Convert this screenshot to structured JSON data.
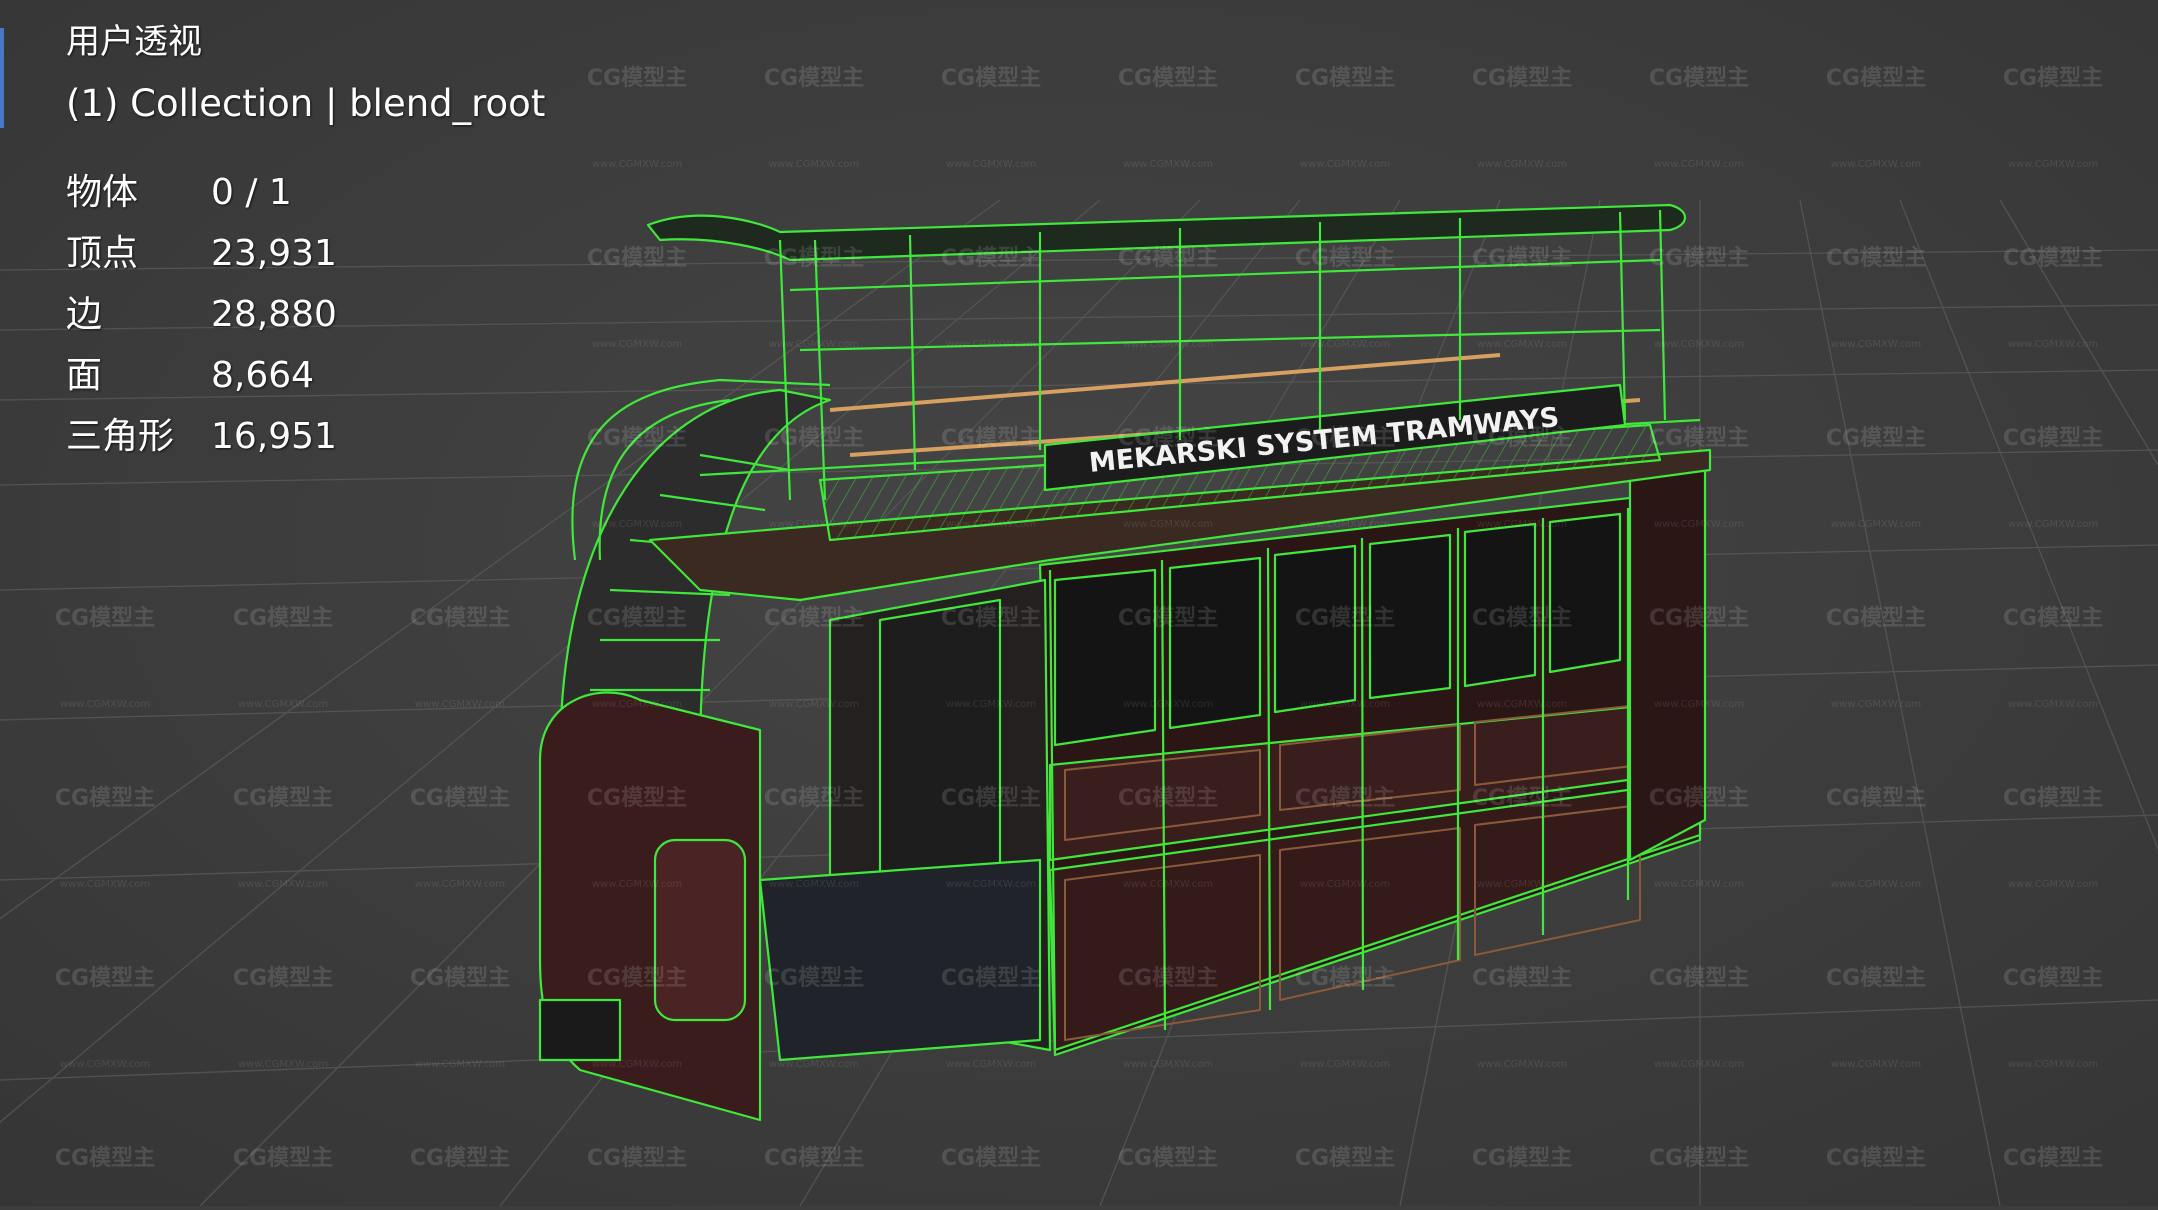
{
  "viewport": {
    "view_name": "用户透视",
    "collection_info": "(1) Collection | blend_root",
    "stats": [
      {
        "label": "物体",
        "value": "0 / 1"
      },
      {
        "label": "顶点",
        "value": "23,931"
      },
      {
        "label": "边",
        "value": "28,880"
      },
      {
        "label": "面",
        "value": "8,664"
      },
      {
        "label": "三角形",
        "value": "16,951"
      }
    ],
    "model": {
      "signboard_text": "MEKARSKI SYSTEM TRAMWAYS",
      "wire_color": "#3fe83a",
      "body_color": "#4a2424"
    },
    "watermark": {
      "logo": "CG模型主",
      "url": "www.CGMXW.com"
    },
    "colors": {
      "background": "#3d3d3d",
      "grid": "#555555",
      "text": "#ffffff"
    }
  }
}
